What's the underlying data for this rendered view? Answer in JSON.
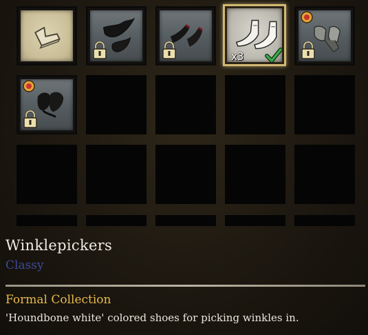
{
  "inventory": {
    "slots": [
      {
        "icon": "shoe-sketch-icon",
        "locked": false
      },
      {
        "icon": "dark-leaf-shoes-icon",
        "locked": true
      },
      {
        "icon": "dark-pointed-shoes-icon",
        "locked": true
      },
      {
        "icon": "white-winklepickers-icon",
        "locked": false,
        "count": "x3",
        "equipped": true,
        "selected": true
      },
      {
        "icon": "grey-shoes-icon",
        "locked": true,
        "badge": "event-badge-icon"
      },
      {
        "icon": "black-curled-shoes-icon",
        "locked": true,
        "badge": "event-badge-icon"
      }
    ],
    "empty_slot_count": 14
  },
  "selected_item": {
    "name": "Winklepickers",
    "rarity": "Classy",
    "rarity_color": "#3f4a9c",
    "collection": "Formal Collection",
    "collection_color": "#e8bb4e",
    "description": "'Houndbone white' colored shoes for picking winkles in."
  }
}
